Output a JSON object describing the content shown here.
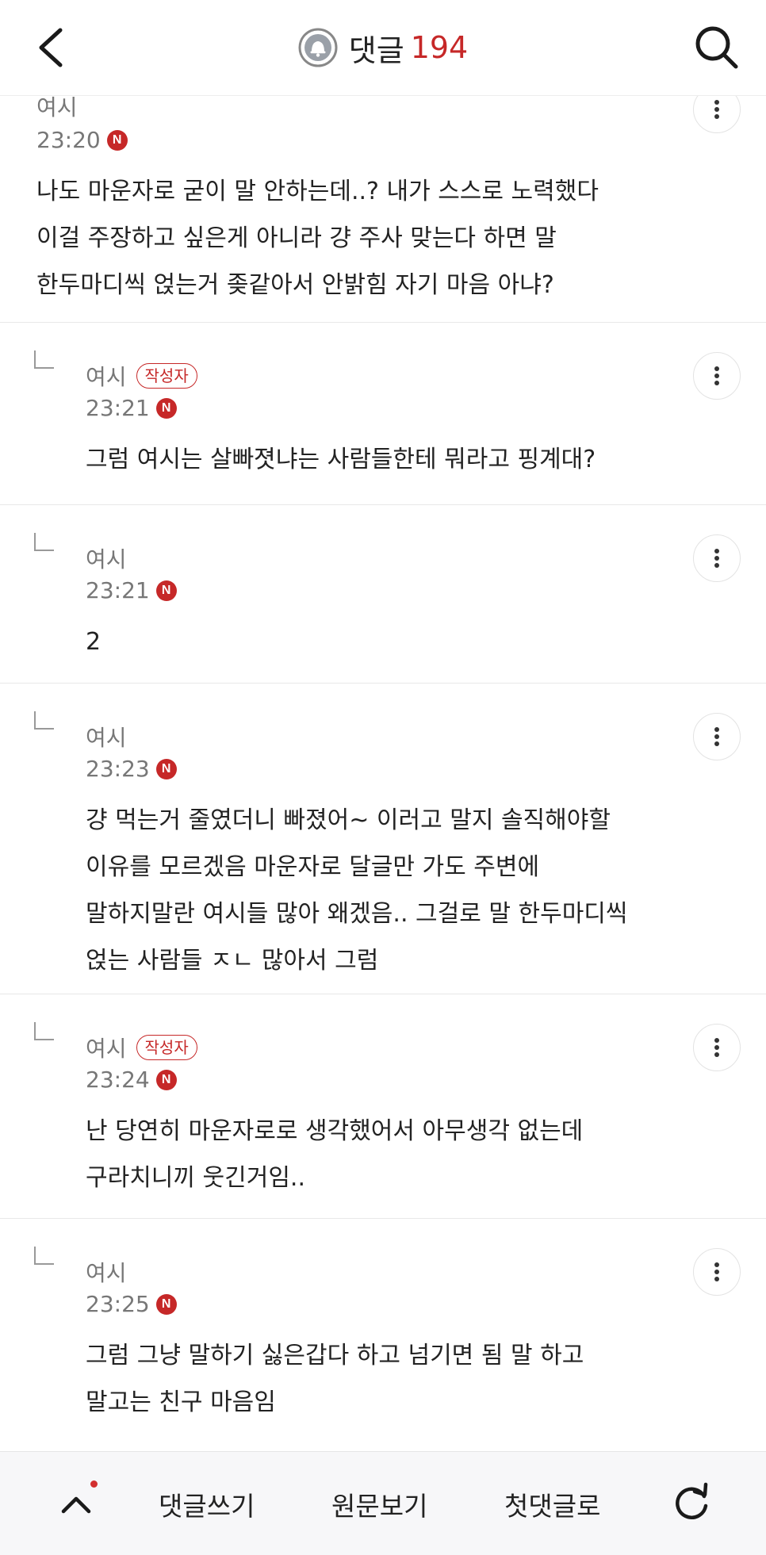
{
  "header": {
    "title": "댓글",
    "count": "194",
    "icons": {
      "back": "back-arrow-icon",
      "bell": "bell-icon",
      "search": "search-icon"
    }
  },
  "comments": [
    {
      "author": "여시",
      "time": "23:20",
      "new_badge": "N",
      "lines": [
        "나도 마운자로 굳이 말 안하는데..? 내가 스스로 노력했다",
        "이걸 주장하고 싶은게 아니라 걍 주사 맞는다 하면 말",
        "한두마디씩 얹는거 좆같아서 안밝힘 자기 마음 아냐?"
      ]
    },
    {
      "author": "여시",
      "writer_badge": "작성자",
      "time": "23:21",
      "new_badge": "N",
      "lines": [
        "그럼 여시는 살빠졋냐는 사람들한테 뭐라고 핑계대?"
      ]
    },
    {
      "author": "여시",
      "time": "23:21",
      "new_badge": "N",
      "lines": [
        "2"
      ]
    },
    {
      "author": "여시",
      "time": "23:23",
      "new_badge": "N",
      "lines": [
        "걍 먹는거 줄였더니 빠졌어~ 이러고 말지 솔직해야할",
        "이유를 모르겠음 마운자로 달글만 가도 주변에",
        "말하지말란 여시들 많아 왜겠음.. 그걸로 말 한두마디씩",
        "얹는 사람들 ㅈㄴ 많아서 그럼"
      ]
    },
    {
      "author": "여시",
      "writer_badge": "작성자",
      "time": "23:24",
      "new_badge": "N",
      "lines": [
        "난 당연히 마운자로로 생각했어서 아무생각 없는데",
        "구라치니끼 웃긴거임.."
      ]
    },
    {
      "author": "여시",
      "time": "23:25",
      "new_badge": "N",
      "lines": [
        "그럼 그냥 말하기 싫은갑다 하고 넘기면 됨 말 하고",
        "말고는 친구 마음임"
      ]
    }
  ],
  "bottom_bar": {
    "write_comment": "댓글쓰기",
    "view_original": "원문보기",
    "first_comment": "첫댓글로",
    "icons": {
      "up": "chevron-up-icon",
      "refresh": "refresh-icon"
    }
  }
}
